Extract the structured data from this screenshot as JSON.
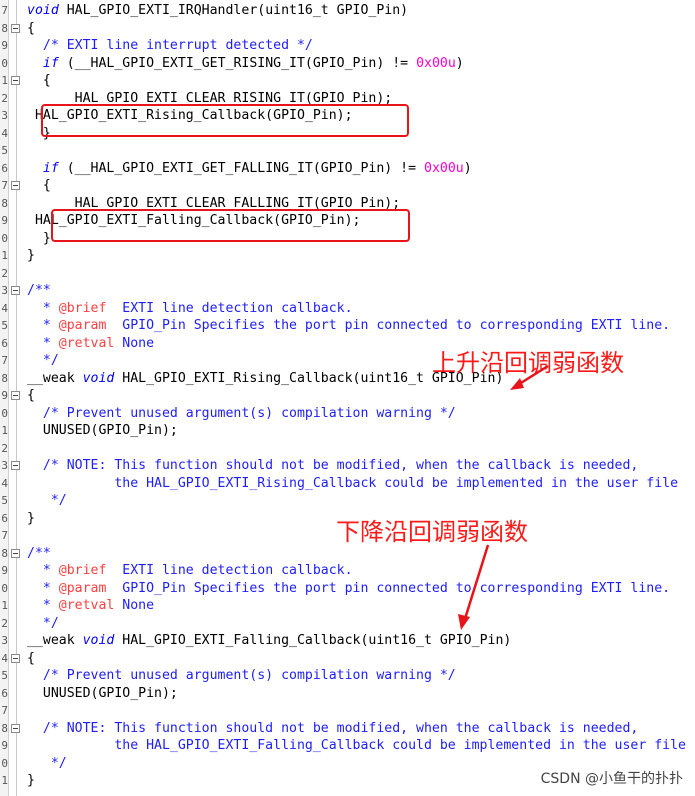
{
  "editor": {
    "lines": [
      {
        "code": "void HAL_GPIO_EXTI_IRQHandler(uint16_t GPIO_Pin)",
        "fold": false
      },
      {
        "code": "{",
        "fold": true
      },
      {
        "code": "  /* EXTI line interrupt detected */",
        "fold": false
      },
      {
        "code": "  if (__HAL_GPIO_EXTI_GET_RISING_IT(GPIO_Pin) != 0x00u)",
        "fold": false
      },
      {
        "code": "  {",
        "fold": true
      },
      {
        "code": "    __HAL_GPIO_EXTI_CLEAR_RISING_IT(GPIO_Pin);",
        "fold": false
      },
      {
        "code": " HAL_GPIO_EXTI_Rising_Callback(GPIO_Pin);",
        "fold": false
      },
      {
        "code": "  }",
        "fold": false
      },
      {
        "code": "",
        "fold": false
      },
      {
        "code": "  if (__HAL_GPIO_EXTI_GET_FALLING_IT(GPIO_Pin) != 0x00u)",
        "fold": false
      },
      {
        "code": "  {",
        "fold": true
      },
      {
        "code": "    __HAL_GPIO_EXTI_CLEAR_FALLING_IT(GPIO_Pin);",
        "fold": false
      },
      {
        "code": " HAL_GPIO_EXTI_Falling_Callback(GPIO_Pin);",
        "fold": false
      },
      {
        "code": "  }",
        "fold": false
      },
      {
        "code": "}",
        "fold": false
      },
      {
        "code": "",
        "fold": false
      },
      {
        "code": "/**",
        "fold": true
      },
      {
        "code": "  * @brief  EXTI line detection callback.",
        "fold": false
      },
      {
        "code": "  * @param  GPIO_Pin Specifies the port pin connected to corresponding EXTI line.",
        "fold": false
      },
      {
        "code": "  * @retval None",
        "fold": false
      },
      {
        "code": "  */",
        "fold": false
      },
      {
        "code": "__weak void HAL_GPIO_EXTI_Rising_Callback(uint16_t GPIO_Pin)",
        "fold": false
      },
      {
        "code": "{",
        "fold": true
      },
      {
        "code": "  /* Prevent unused argument(s) compilation warning */",
        "fold": false
      },
      {
        "code": "  UNUSED(GPIO_Pin);",
        "fold": false
      },
      {
        "code": "",
        "fold": false
      },
      {
        "code": "  /* NOTE: This function should not be modified, when the callback is needed,",
        "fold": true
      },
      {
        "code": "           the HAL_GPIO_EXTI_Rising_Callback could be implemented in the user file",
        "fold": false
      },
      {
        "code": "   */",
        "fold": false
      },
      {
        "code": "}",
        "fold": false
      },
      {
        "code": "",
        "fold": false
      },
      {
        "code": "/**",
        "fold": true
      },
      {
        "code": "  * @brief  EXTI line detection callback.",
        "fold": false
      },
      {
        "code": "  * @param  GPIO_Pin Specifies the port pin connected to corresponding EXTI line.",
        "fold": false
      },
      {
        "code": "  * @retval None",
        "fold": false
      },
      {
        "code": "  */",
        "fold": false
      },
      {
        "code": "__weak void HAL_GPIO_EXTI_Falling_Callback(uint16_t GPIO_Pin)",
        "fold": false
      },
      {
        "code": "{",
        "fold": true
      },
      {
        "code": "  /* Prevent unused argument(s) compilation warning */",
        "fold": false
      },
      {
        "code": "  UNUSED(GPIO_Pin);",
        "fold": false
      },
      {
        "code": "",
        "fold": false
      },
      {
        "code": "  /* NOTE: This function should not be modified, when the callback is needed,",
        "fold": true
      },
      {
        "code": "           the HAL_GPIO_EXTI_Falling_Callback could be implemented in the user file",
        "fold": false
      },
      {
        "code": "   */",
        "fold": false
      },
      {
        "code": "}",
        "fold": false
      }
    ]
  },
  "annotations": {
    "rising_note": "上升沿回调弱函数",
    "falling_note": "下降沿回调弱函数"
  },
  "watermark": "CSDN @小鱼干的扑扑",
  "colors": {
    "keyword": "#0000ff",
    "comment": "#1e1eff",
    "doc_tag": "#ff4040",
    "number": "#ff00cc",
    "annotation": "#e8141a"
  }
}
